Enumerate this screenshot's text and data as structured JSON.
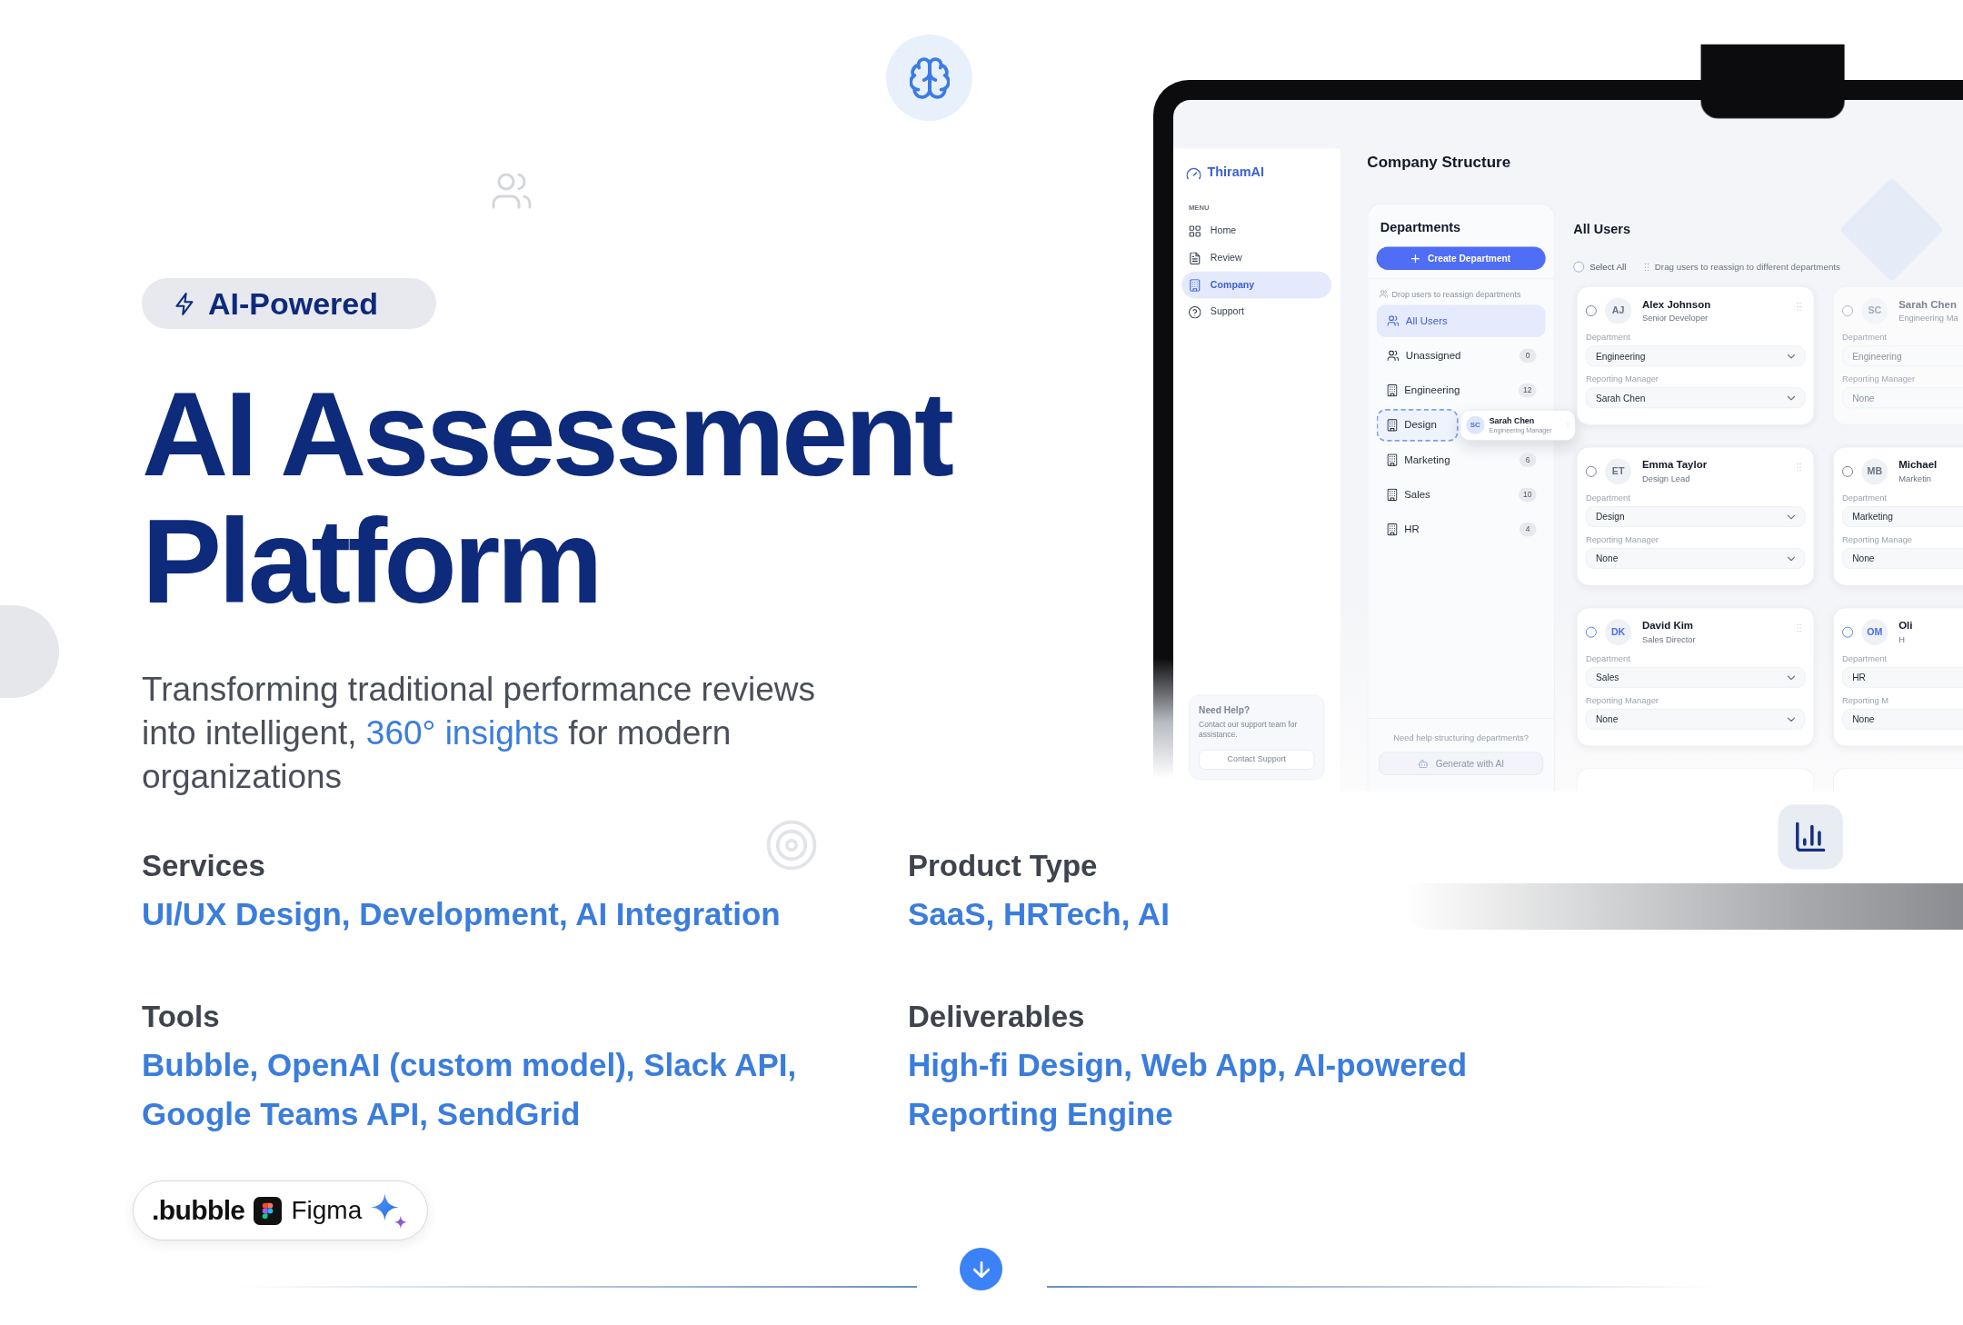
{
  "hero": {
    "badge": "AI-Powered",
    "title": "AI Assessment Platform",
    "tagline": [
      {
        "text": "Transforming traditional performance reviews into intelligent, ",
        "highlight": false
      },
      {
        "text": "360° insights",
        "highlight": true
      },
      {
        "text": " for modern organizations",
        "highlight": false
      }
    ]
  },
  "details": [
    {
      "label": "Services",
      "value": "UI/UX Design, Development, AI Integration"
    },
    {
      "label": "Product Type",
      "value": "SaaS, HRTech, AI"
    },
    {
      "label": "Tools",
      "value": "Bubble, OpenAI (custom model), Slack API, Google Teams API, SendGrid"
    },
    {
      "label": "Deliverables",
      "value": "High-fi Design, Web App, AI-powered Reporting Engine"
    }
  ],
  "tool_logos": [
    {
      "kind": "bubble",
      "label": ".bubble"
    },
    {
      "kind": "figma",
      "label": "Figma"
    },
    {
      "kind": "gemini"
    }
  ],
  "app": {
    "brand": "ThiramAI",
    "menu_heading": "MENU",
    "menu": [
      {
        "label": "Home",
        "selected": false
      },
      {
        "label": "Review",
        "selected": false
      },
      {
        "label": "Company",
        "selected": true
      },
      {
        "label": "Support",
        "selected": false
      }
    ],
    "help_card": {
      "title": "Need Help?",
      "text": "Contact our support team for assistance.",
      "button": "Contact Support"
    },
    "page_title": "Company Structure",
    "departments": {
      "title": "Departments",
      "create_button": "Create Department",
      "hint": "Drop users to reassign departments",
      "items": [
        {
          "label": "All Users",
          "selected": true,
          "drop_target": false
        },
        {
          "label": "Unassigned",
          "count": "0",
          "selected": false,
          "drop_target": false
        },
        {
          "label": "Engineering",
          "count": "12",
          "selected": false,
          "drop_target": false
        },
        {
          "label": "Design",
          "selected": false,
          "drop_target": true
        },
        {
          "label": "Marketing",
          "count": "6",
          "selected": false,
          "drop_target": false
        },
        {
          "label": "Sales",
          "count": "10",
          "selected": false,
          "drop_target": false
        },
        {
          "label": "HR",
          "count": "4",
          "selected": false,
          "drop_target": false
        }
      ],
      "footer_text": "Need help structuring departments?",
      "ai_button": "Generate with AI"
    },
    "dragged_user": {
      "initials": "SC",
      "name": "Sarah Chen",
      "role": "Engineering Manager"
    },
    "users": {
      "title": "All Users",
      "select_all": {
        "label": "Select All",
        "checked": false
      },
      "hint": "Drag users to reassign to different departments",
      "cards": [
        {
          "initials": "AJ",
          "name": "Alex Johnson",
          "role": "Senior Developer",
          "department_label": "Department",
          "department": "Engineering",
          "manager_label": "Reporting Manager",
          "manager": "Sarah Chen",
          "color": "#6b7280",
          "selected": false,
          "dragging": false
        },
        {
          "initials": "SC",
          "name": "Sarah Chen",
          "role": "Engineering Ma",
          "department_label": "Department",
          "department": "Engineering",
          "manager_label": "Reporting Manager",
          "manager": "None",
          "color": "#a3abbb",
          "selected": false,
          "dragging": true
        },
        {
          "initials": "ET",
          "name": "Emma Taylor",
          "role": "Design Lead",
          "department_label": "Department",
          "department": "Design",
          "manager_label": "Reporting Manager",
          "manager": "None",
          "color": "#6b7280",
          "selected": false,
          "dragging": false
        },
        {
          "initials": "MB",
          "name": "Michael",
          "role": "Marketin",
          "department_label": "Department",
          "department": "Marketing",
          "manager_label": "Reporting Manage",
          "manager": "None",
          "color": "#6b7280",
          "selected": false,
          "dragging": false
        },
        {
          "initials": "DK",
          "name": "David Kim",
          "role": "Sales Director",
          "department_label": "Department",
          "department": "Sales",
          "manager_label": "Reporting Manager",
          "manager": "None",
          "color": "#4c6ee0",
          "selected": false,
          "dragging": false
        },
        {
          "initials": "OM",
          "name": "Oli",
          "role": "H",
          "department_label": "Department",
          "department": "HR",
          "manager_label": "Reporting M",
          "manager": "None",
          "color": "#4c6ee0",
          "selected": false,
          "dragging": false
        }
      ]
    }
  }
}
